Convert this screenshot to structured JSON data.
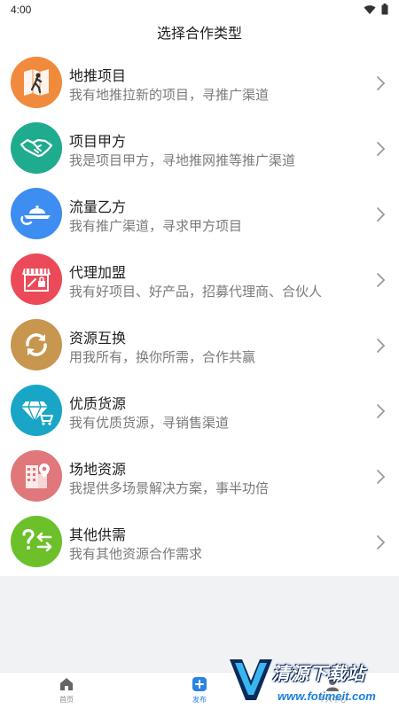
{
  "status_bar": {
    "time": "4:00"
  },
  "header": {
    "title": "选择合作类型"
  },
  "items": [
    {
      "title": "地推项目",
      "desc": "我有地推拉新的项目，寻推广渠道",
      "color": "#f08a3c",
      "icon": "walking-person-map-icon"
    },
    {
      "title": "项目甲方",
      "desc": "我是项目甲方，寻地推网推等推广渠道",
      "color": "#1fab8e",
      "icon": "handshake-icon"
    },
    {
      "title": "流量乙方",
      "desc": "我有推广渠道，寻求甲方项目",
      "color": "#3e8df0",
      "icon": "cloche-serving-icon"
    },
    {
      "title": "代理加盟",
      "desc": "我有好项目、好产品，招募代理商、合伙人",
      "color": "#ec4a58",
      "icon": "storefront-lock-icon"
    },
    {
      "title": "资源互换",
      "desc": "用我所有，换你所需，合作共赢",
      "color": "#c7964f",
      "icon": "exchange-arrows-icon"
    },
    {
      "title": "优质货源",
      "desc": "我有优质货源，寻销售渠道",
      "color": "#19a6c6",
      "icon": "diamond-cart-icon"
    },
    {
      "title": "场地资源",
      "desc": "我提供多场景解决方案，事半功倍",
      "color": "#e0777a",
      "icon": "building-location-icon"
    },
    {
      "title": "其他供需",
      "desc": "我有其他资源合作需求",
      "color": "#6cc02a",
      "icon": "question-swap-icon"
    }
  ],
  "bottom_nav": {
    "tabs": [
      {
        "label": "首页",
        "icon": "home-icon",
        "active": false
      },
      {
        "label": "发布",
        "icon": "plus-square-icon",
        "active": true
      },
      {
        "label": "个人中心",
        "icon": "user-icon",
        "active": false
      }
    ]
  },
  "watermark": {
    "text": "清源下载站",
    "url": "www.fotimeit.com"
  }
}
